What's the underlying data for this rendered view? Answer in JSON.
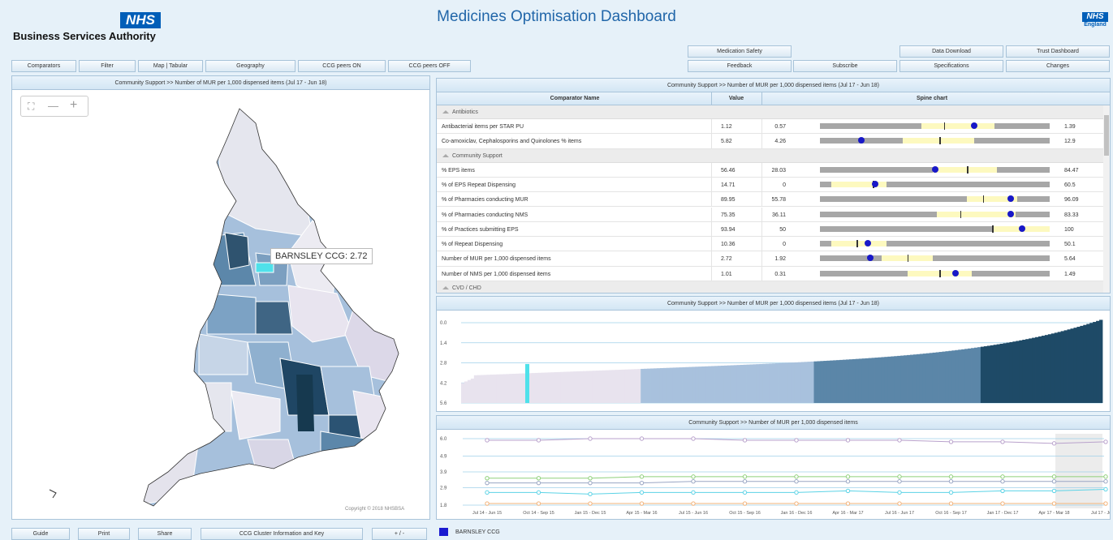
{
  "header": {
    "org_name": "Business Services Authority",
    "nhs_logo": "NHS",
    "title": "Medicines Optimisation Dashboard",
    "nhs_england_logo_top": "NHS",
    "nhs_england_logo_bottom": "England"
  },
  "toolbar_left": [
    "Comparators",
    "Filter",
    "Map | Tabular",
    "Geography",
    "CCG peers ON",
    "CCG peers OFF"
  ],
  "toolbar_right_top": [
    "Medication Safety",
    "",
    "",
    "Data Download",
    "Trust Dashboard"
  ],
  "toolbar_right_bottom": [
    "Feedback",
    "Subscribe",
    "Specifications",
    "Changes"
  ],
  "map_panel": {
    "title": "Community Support >> Number of MUR per 1,000 dispensed items (Jul 17 - Jun 18)",
    "tooltip": "BARNSLEY CCG: 2.72",
    "copyright": "Copyright © 2018 NHSBSA",
    "zoom_out": "—",
    "zoom_in": "+"
  },
  "bottom_buttons": [
    "Guide",
    "Print",
    "Share",
    "CCG Cluster Information and Key",
    "+ / -"
  ],
  "legend": {
    "label": "BARNSLEY CCG",
    "color": "#1a1ad0"
  },
  "table_panel": {
    "title": "Community Support >> Number of MUR per 1,000 dispensed items (Jul 17 - Jun 18)",
    "col_name": "Comparator Name",
    "col_value": "Value",
    "col_spine": "Spine chart",
    "groups": [
      {
        "name": "Antibiotics",
        "rows": [
          {
            "name": "Antibacterial items per STAR PU",
            "value": "1.12",
            "min": "0.57",
            "max": "1.39",
            "band": [
              0.44,
              0.76
            ],
            "median": 0.54,
            "dot": 0.67
          },
          {
            "name": "Co-amoxiclav, Cephalosporins and Quinolones % items",
            "value": "5.82",
            "min": "4.26",
            "max": "12.9",
            "band": [
              0.36,
              0.67
            ],
            "median": 0.52,
            "dot": 0.18
          }
        ]
      },
      {
        "name": "Community Support",
        "rows": [
          {
            "name": "% EPS items",
            "value": "56.46",
            "min": "28.03",
            "max": "84.47",
            "band": [
              0.49,
              0.77
            ],
            "median": 0.64,
            "dot": 0.5
          },
          {
            "name": "% of EPS Repeat Dispensing",
            "value": "14.71",
            "min": "0",
            "max": "60.5",
            "band": [
              0.05,
              0.29
            ],
            "median": 0.23,
            "dot": 0.24
          },
          {
            "name": "% of Pharmacies conducting MUR",
            "value": "89.95",
            "min": "55.78",
            "max": "96.09",
            "band": [
              0.64,
              0.86
            ],
            "median": 0.71,
            "dot": 0.83
          },
          {
            "name": "% of Pharmacies conducting NMS",
            "value": "75.35",
            "min": "36.11",
            "max": "83.33",
            "band": [
              0.51,
              0.85
            ],
            "median": 0.61,
            "dot": 0.83
          },
          {
            "name": "% of Practices submitting EPS",
            "value": "93.94",
            "min": "50",
            "max": "100",
            "band": [
              0.75,
              1.0
            ],
            "median": 0.75,
            "dot": 0.88
          },
          {
            "name": "% of Repeat Dispensing",
            "value": "10.36",
            "min": "0",
            "max": "50.1",
            "band": [
              0.05,
              0.29
            ],
            "median": 0.16,
            "dot": 0.21
          },
          {
            "name": "Number of MUR per 1,000 dispensed items",
            "value": "2.72",
            "min": "1.92",
            "max": "5.64",
            "band": [
              0.27,
              0.49
            ],
            "median": 0.38,
            "dot": 0.22
          },
          {
            "name": "Number of NMS per 1,000 dispensed items",
            "value": "1.01",
            "min": "0.31",
            "max": "1.49",
            "band": [
              0.38,
              0.66
            ],
            "median": 0.52,
            "dot": 0.59
          }
        ]
      },
      {
        "name": "CVD / CHD",
        "rows": []
      }
    ]
  },
  "rank_panel": {
    "title": "Community Support >> Number of MUR per 1,000 dispensed items (Jul 17 - Jun 18)",
    "y_ticks": [
      "5.6",
      "4.2",
      "2.8",
      "1.4",
      "0.0"
    ],
    "highlight_color": "#4fe1ea"
  },
  "trend_panel": {
    "title": "Community Support >> Number of MUR per 1,000 dispensed items",
    "y_ticks": [
      "6.0",
      "4.9",
      "3.9",
      "2.9",
      "1.8"
    ],
    "x_ticks": [
      "Jul 14 - Jun 15",
      "Oct 14 - Sep 15",
      "Jan 15 - Dec 15",
      "Apr 15 - Mar 16",
      "Jul 15 - Jun 16",
      "Oct 15 - Sep 16",
      "Jan 16 - Dec 16",
      "Apr 16 - Mar 17",
      "Jul 16 - Jun 17",
      "Oct 16 - Sep 17",
      "Jan 17 - Dec 17",
      "Apr 17 - Mar 18",
      "Jul 17 - Jun 18"
    ]
  },
  "chart_data": [
    {
      "type": "bar",
      "title": "Community Support >> Number of MUR per 1,000 dispensed items (Jul 17 - Jun 18)",
      "ylim": [
        0,
        5.6
      ],
      "y_ticks": [
        0.0,
        1.4,
        2.8,
        4.2,
        5.6
      ],
      "description_series": "CCGs ranked ascending, coloured by quartile",
      "quartile_colors": [
        "#e8e3ee",
        "#a8c1dd",
        "#5b86a8",
        "#1e4a67"
      ],
      "highlight": {
        "name": "BARNSLEY CCG",
        "value": 2.72
      }
    },
    {
      "type": "line",
      "title": "Community Support >> Number of MUR per 1,000 dispensed items",
      "x": [
        "Jul 14 - Jun 15",
        "Oct 14 - Sep 15",
        "Jan 15 - Dec 15",
        "Apr 15 - Mar 16",
        "Jul 15 - Jun 16",
        "Oct 15 - Sep 16",
        "Jan 16 - Dec 16",
        "Apr 16 - Mar 17",
        "Jul 16 - Jun 17",
        "Oct 16 - Sep 17",
        "Jan 17 - Dec 17",
        "Apr 17 - Mar 18",
        "Jul 17 - Jun 18"
      ],
      "ylim": [
        1.8,
        6.0
      ],
      "series": [
        {
          "color": "#b9a2cc",
          "values": [
            5.9,
            5.9,
            6.0,
            6.0,
            6.0,
            5.9,
            5.9,
            5.9,
            5.9,
            5.8,
            5.8,
            5.7,
            5.8
          ]
        },
        {
          "color": "#8fd07a",
          "values": [
            3.5,
            3.5,
            3.5,
            3.6,
            3.6,
            3.6,
            3.6,
            3.6,
            3.6,
            3.6,
            3.6,
            3.6,
            3.6
          ]
        },
        {
          "color": "#9aa6c4",
          "values": [
            3.2,
            3.2,
            3.2,
            3.2,
            3.3,
            3.3,
            3.3,
            3.3,
            3.3,
            3.3,
            3.3,
            3.3,
            3.3
          ]
        },
        {
          "color": "#5bd3e6",
          "values": [
            2.6,
            2.6,
            2.5,
            2.6,
            2.6,
            2.6,
            2.6,
            2.7,
            2.6,
            2.6,
            2.7,
            2.7,
            2.8
          ]
        },
        {
          "color": "#f2b37a",
          "values": [
            1.9,
            1.9,
            1.9,
            1.9,
            1.9,
            1.9,
            1.9,
            1.9,
            1.9,
            1.9,
            1.9,
            1.9,
            1.9
          ]
        }
      ]
    }
  ]
}
